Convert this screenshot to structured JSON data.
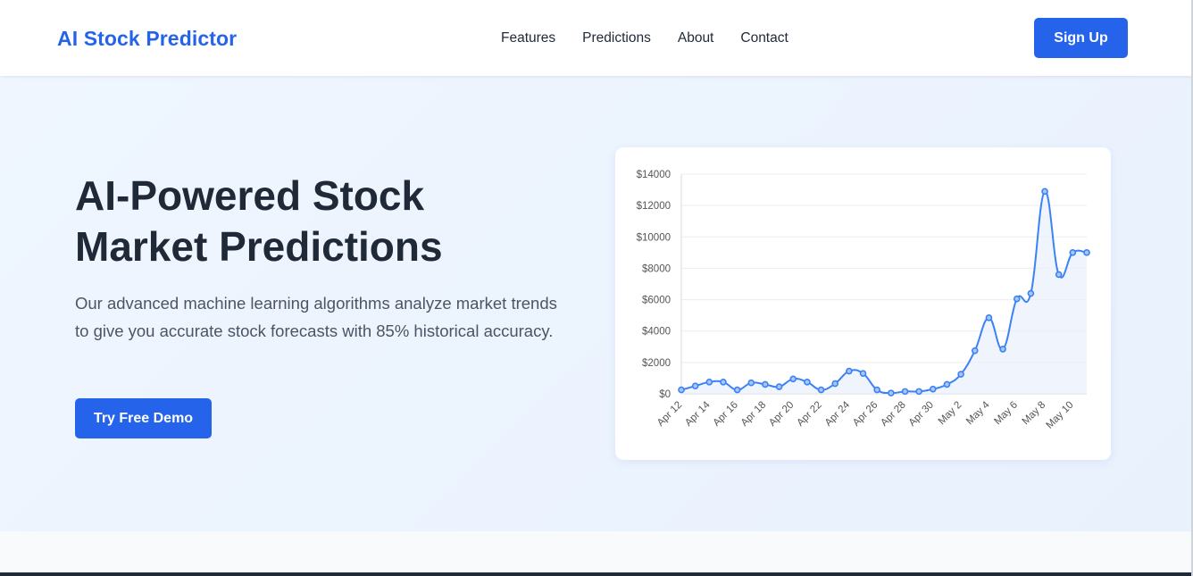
{
  "navbar": {
    "brand": "AI Stock Predictor",
    "links": [
      "Features",
      "Predictions",
      "About",
      "Contact"
    ],
    "signup_label": "Sign Up"
  },
  "hero": {
    "title_line1": "AI-Powered Stock",
    "title_line2": "Market Predictions",
    "description": "Our advanced machine learning algorithms analyze market trends to give you accurate stock forecasts with 85% historical accuracy.",
    "demo_label": "Try Free Demo"
  },
  "colors": {
    "accent": "#2563eb",
    "line": "#3b82f6",
    "fill": "#e8effc"
  },
  "chart_data": {
    "type": "line",
    "title": "",
    "xlabel": "",
    "ylabel": "",
    "ylim": [
      0,
      14000
    ],
    "yticks": [
      0,
      2000,
      4000,
      6000,
      8000,
      10000,
      12000,
      14000
    ],
    "ytick_labels": [
      "$0",
      "$2000",
      "$4000",
      "$6000",
      "$8000",
      "$10000",
      "$12000",
      "$14000"
    ],
    "x": [
      "Apr 12",
      "Apr 13",
      "Apr 14",
      "Apr 15",
      "Apr 16",
      "Apr 17",
      "Apr 18",
      "Apr 19",
      "Apr 20",
      "Apr 21",
      "Apr 22",
      "Apr 23",
      "Apr 24",
      "Apr 25",
      "Apr 26",
      "Apr 27",
      "Apr 28",
      "Apr 29",
      "Apr 30",
      "May 1",
      "May 2",
      "May 3",
      "May 4",
      "May 5",
      "May 6",
      "May 7",
      "May 8",
      "May 9",
      "May 10",
      "May 11"
    ],
    "xtick_labels": [
      "Apr 12",
      "Apr 14",
      "Apr 16",
      "Apr 18",
      "Apr 20",
      "Apr 22",
      "Apr 24",
      "Apr 26",
      "Apr 28",
      "Apr 30",
      "May 2",
      "May 4",
      "May 6",
      "May 8",
      "May 10"
    ],
    "grid": true,
    "series": [
      {
        "values": [
          250,
          500,
          750,
          750,
          250,
          700,
          600,
          450,
          950,
          750,
          250,
          650,
          1450,
          1300,
          250,
          50,
          150,
          150,
          300,
          600,
          1250,
          2750,
          4850,
          2850,
          6050,
          6400,
          12900,
          7600,
          9000,
          9000
        ]
      }
    ]
  }
}
